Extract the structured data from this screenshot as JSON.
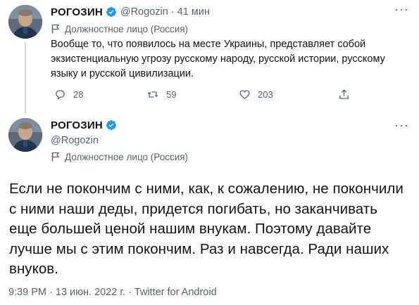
{
  "tweet1": {
    "name": "РОГОЗИН",
    "handle": "@Rogozin",
    "separator": "·",
    "time": "41 мин",
    "label": "Должностное лицо (Россия)",
    "text": "Вообще то, что появилось на месте Украины, представляет собой экзистенциальную угрозу русскому народу, русской истории, русскому языку и русской цивилизации.",
    "replies": "28",
    "retweets": "59",
    "likes": "203"
  },
  "tweet2": {
    "name": "РОГОЗИН",
    "handle": "@Rogozin",
    "label": "Должностное лицо (Россия)",
    "text": "Если не покончим с ними, как, к сожалению, не покончили с ними наши деды, придется погибать, но заканчивать еще большей ценой нашим внукам. Поэтому давайте лучше мы с этим покончим. Раз и навсегда. Ради наших внуков.",
    "meta": "9:39 PM · 13 июн. 2022 г. · Twitter for Android"
  },
  "colors": {
    "text": "#0f1419",
    "secondary": "#536471",
    "verified": "#1d9bf0",
    "divider": "#eff3f4"
  },
  "icons": {
    "verified": "verified-badge-icon",
    "label": "flag-icon",
    "reply": "reply-icon",
    "retweet": "retweet-icon",
    "like": "heart-icon",
    "share": "share-icon",
    "more": "more-icon"
  }
}
